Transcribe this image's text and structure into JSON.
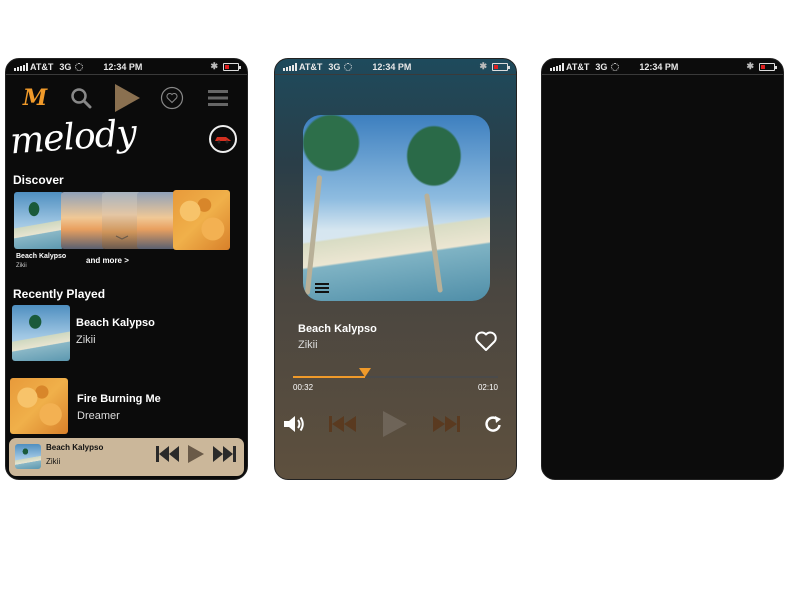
{
  "status": {
    "carrier": "AT&T",
    "network": "3G",
    "time": "12:34 PM"
  },
  "home": {
    "brand": "melody",
    "discover_title": "Discover",
    "featured": {
      "title": "Beach Kalypso",
      "artist": "Zikii"
    },
    "more_label": "and more >",
    "recent_title": "Recently Played",
    "recent": [
      {
        "title": "Beach Kalypso",
        "artist": "Zikii"
      },
      {
        "title": "Fire Burning Me",
        "artist": "Dreamer"
      }
    ],
    "mini_player": {
      "title": "Beach Kalypso",
      "artist": "Zikii"
    }
  },
  "now_playing": {
    "title": "Beach Kalypso",
    "artist": "Zikii",
    "elapsed": "00:32",
    "duration": "02:10",
    "progress": 0.35
  },
  "colors": {
    "accent": "#f09a2a",
    "mini_player_bg": "#cbb79a",
    "dark_bg": "#0b0b0b"
  },
  "icons": {
    "nav": [
      "logo-m-icon",
      "search-icon",
      "play-icon",
      "heart-circle-icon",
      "menu-icon"
    ],
    "player": [
      "volume-icon",
      "rewind-icon",
      "play-icon",
      "fast-forward-icon",
      "repeat-icon"
    ]
  }
}
